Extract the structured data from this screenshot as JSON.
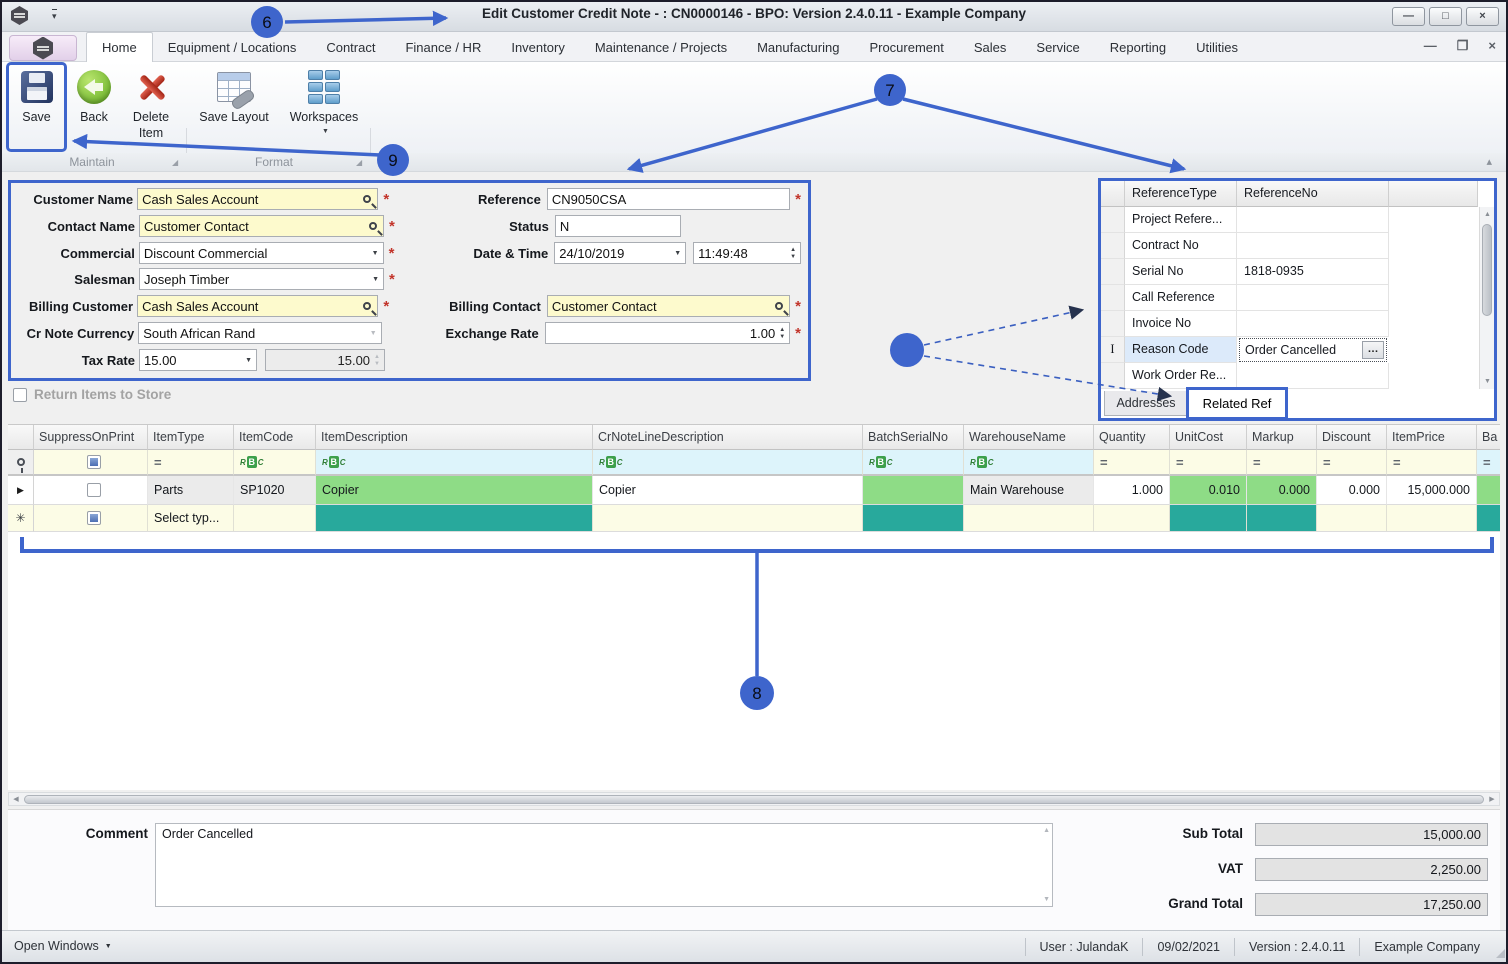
{
  "window": {
    "title": "Edit Customer Credit Note - : CN0000146 - BPO: Version 2.4.0.11 - Example Company"
  },
  "icons": {
    "titlebar_chevron": "▾",
    "minimize": "—",
    "maximize": "□",
    "close": "×",
    "mdi_minimize": "—",
    "mdi_restore": "❐",
    "mdi_close": "×",
    "dropdown": "▼",
    "spin_up": "▲",
    "spin_down": "▼",
    "equals": "=",
    "abc_r": "R",
    "abc_b": "B",
    "abc_c": "C",
    "row_current": "▶",
    "row_new": "✳",
    "ellipsis": "…",
    "required": "*",
    "collapse": "▴",
    "group_corner": "◢",
    "scroll_left": "◀",
    "scroll_right": "▶",
    "scroll_up": "▲",
    "scroll_down": "▼",
    "ibeam": "I",
    "open_windows_caret": "▼",
    "workspaces_caret": "▼"
  },
  "ribbon": {
    "tabs": [
      "Home",
      "Equipment / Locations",
      "Contract",
      "Finance / HR",
      "Inventory",
      "Maintenance / Projects",
      "Manufacturing",
      "Procurement",
      "Sales",
      "Service",
      "Reporting",
      "Utilities"
    ],
    "toolbar": {
      "save": "Save",
      "back": "Back",
      "delete_item": "Delete Item",
      "save_layout": "Save Layout",
      "workspaces": "Workspaces"
    },
    "groups": {
      "maintain": "Maintain",
      "format": "Format"
    }
  },
  "form": {
    "customer_name": {
      "label": "Customer Name",
      "value": "Cash Sales Account"
    },
    "contact_name": {
      "label": "Contact Name",
      "value": "Customer Contact"
    },
    "commercial": {
      "label": "Commercial",
      "value": "Discount Commercial"
    },
    "salesman": {
      "label": "Salesman",
      "value": "Joseph Timber"
    },
    "billing_customer": {
      "label": "Billing Customer",
      "value": "Cash Sales Account"
    },
    "cr_note_currency": {
      "label": "Cr Note Currency",
      "value": "South African Rand"
    },
    "tax_rate": {
      "label": "Tax Rate",
      "value": "15.00",
      "value2": "15.00"
    },
    "reference": {
      "label": "Reference",
      "value": "CN9050CSA"
    },
    "status": {
      "label": "Status",
      "value": "N"
    },
    "date_time": {
      "label": "Date & Time",
      "date": "24/10/2019",
      "time": "11:49:48"
    },
    "billing_contact": {
      "label": "Billing Contact",
      "value": "Customer Contact"
    },
    "exchange_rate": {
      "label": "Exchange Rate",
      "value": "1.00"
    }
  },
  "ref_panel": {
    "col_type": "ReferenceType",
    "col_no": "ReferenceNo",
    "rows": [
      {
        "type": "Project Refere...",
        "no": ""
      },
      {
        "type": "Contract No",
        "no": ""
      },
      {
        "type": "Serial No",
        "no": "1818-0935"
      },
      {
        "type": "Call Reference",
        "no": ""
      },
      {
        "type": "Invoice No",
        "no": ""
      },
      {
        "type": "Reason Code",
        "no": "Order Cancelled"
      },
      {
        "type": "Work Order Re...",
        "no": ""
      }
    ],
    "tab_addresses": "Addresses",
    "tab_related": "Related Ref"
  },
  "return_items": {
    "label": "Return Items to Store"
  },
  "grid": {
    "columns": [
      "SuppressOnPrint",
      "ItemType",
      "ItemCode",
      "ItemDescription",
      "CrNoteLineDescription",
      "BatchSerialNo",
      "WarehouseName",
      "Quantity",
      "UnitCost",
      "Markup",
      "Discount",
      "ItemPrice",
      "Ba"
    ],
    "row1": {
      "item_type": "Parts",
      "item_code": "SP1020",
      "item_description": "Copier",
      "cr_note_line_description": "Copier",
      "batch_serial_no": "",
      "warehouse_name": "Main Warehouse",
      "quantity": "1.000",
      "unit_cost": "0.010",
      "markup": "0.000",
      "discount": "0.000",
      "item_price": "15,000.000"
    },
    "new_row": {
      "item_type": "Select typ..."
    }
  },
  "comment": {
    "label": "Comment",
    "value": "Order Cancelled"
  },
  "totals": {
    "sub_label": "Sub Total",
    "sub_value": "15,000.00",
    "vat_label": "VAT",
    "vat_value": "2,250.00",
    "grand_label": "Grand Total",
    "grand_value": "17,250.00"
  },
  "statusbar": {
    "open_windows": "Open Windows",
    "user": "User : JulandaK",
    "date": "09/02/2021",
    "version": "Version : 2.4.0.11",
    "company": "Example Company"
  },
  "annotations": {
    "n6": "6",
    "n7": "7",
    "n8": "8",
    "n9": "9"
  }
}
